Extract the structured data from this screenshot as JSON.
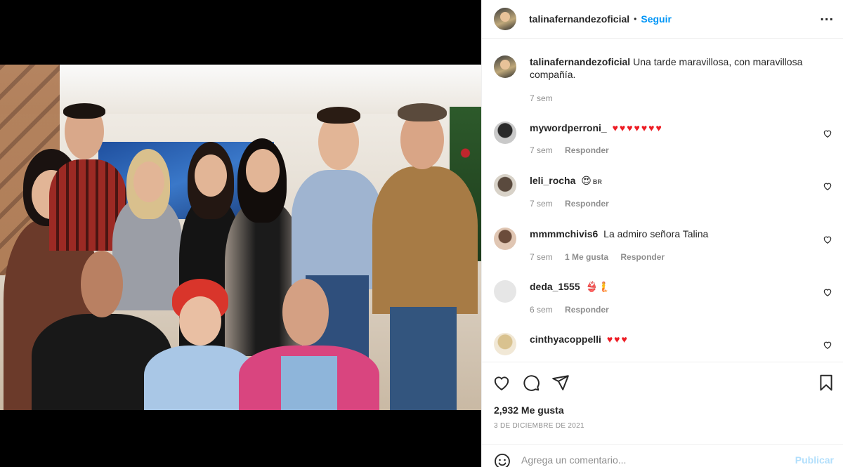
{
  "post": {
    "username": "talinafernandezoficial",
    "separator": "•",
    "follow_label": "Seguir",
    "more_label": "...",
    "caption": {
      "username": "talinafernandezoficial",
      "text": "Una tarde maravillosa, con maravillosa compañía.",
      "time": "7 sem"
    },
    "comments": [
      {
        "username": "mywordperroni_",
        "text": "♥♥♥♥♥♥♥",
        "time": "7 sem",
        "likes": "",
        "reply": "Responder"
      },
      {
        "username": "leli_rocha",
        "text": "😍",
        "tag": "BR",
        "time": "7 sem",
        "likes": "",
        "reply": "Responder"
      },
      {
        "username": "mmmmchivis6",
        "text": "La admiro señora Talina",
        "time": "7 sem",
        "likes": "1 Me gusta",
        "reply": "Responder"
      },
      {
        "username": "deda_1555",
        "text": "👙🧜",
        "time": "6 sem",
        "likes": "",
        "reply": "Responder"
      },
      {
        "username": "cinthyacoppelli",
        "text": "♥♥♥",
        "time": "",
        "likes": "",
        "reply": ""
      }
    ],
    "likes_label": "2,932 Me gusta",
    "date": "3 DE DICIEMBRE DE 2021",
    "comment_placeholder": "Agrega un comentario...",
    "publish_label": "Publicar"
  },
  "icons": {
    "like": "heart-icon",
    "comment": "comment-icon",
    "share": "send-icon",
    "save": "bookmark-icon",
    "emoji": "emoji-icon",
    "tagged_user": "user-tag-icon",
    "options": "more-options-icon"
  },
  "colors": {
    "accent": "#0095f6",
    "muted": "#8e8e8e",
    "heart": "#ed1c24",
    "publish_disabled": "#b2dffc"
  }
}
